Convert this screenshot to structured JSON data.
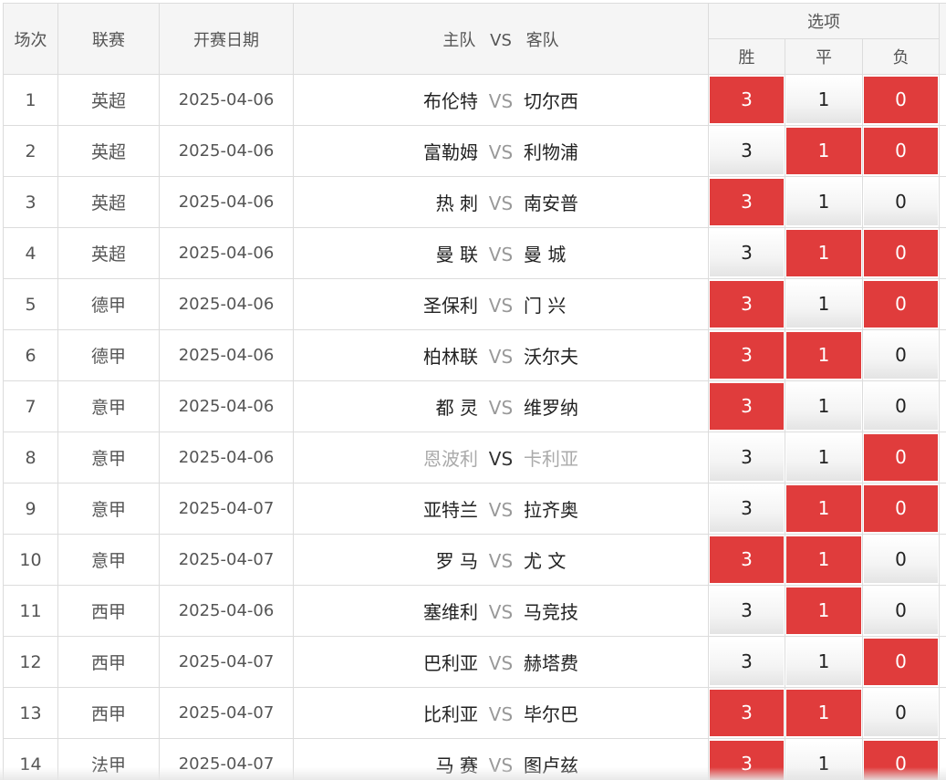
{
  "headers": {
    "num": "场次",
    "league": "联赛",
    "date": "开赛日期",
    "home": "主队",
    "vs": "VS",
    "away": "客队",
    "options": "选项",
    "win": "胜",
    "draw": "平",
    "lose": "负"
  },
  "colors": {
    "selected": "#e03c3c",
    "vs_text": "#999999"
  },
  "matches": [
    {
      "num": "1",
      "league": "英超",
      "date": "2025-04-06",
      "home": "布伦特",
      "vs": "VS",
      "away": "切尔西",
      "win": "3",
      "draw": "1",
      "lose": "0"
    },
    {
      "num": "2",
      "league": "英超",
      "date": "2025-04-06",
      "home": "富勒姆",
      "vs": "VS",
      "away": "利物浦",
      "win": "3",
      "draw": "1",
      "lose": "0"
    },
    {
      "num": "3",
      "league": "英超",
      "date": "2025-04-06",
      "home": "热 刺",
      "vs": "VS",
      "away": "南安普",
      "win": "3",
      "draw": "1",
      "lose": "0"
    },
    {
      "num": "4",
      "league": "英超",
      "date": "2025-04-06",
      "home": "曼 联",
      "vs": "VS",
      "away": "曼 城",
      "win": "3",
      "draw": "1",
      "lose": "0"
    },
    {
      "num": "5",
      "league": "德甲",
      "date": "2025-04-06",
      "home": "圣保利",
      "vs": "VS",
      "away": "门 兴",
      "win": "3",
      "draw": "1",
      "lose": "0"
    },
    {
      "num": "6",
      "league": "德甲",
      "date": "2025-04-06",
      "home": "柏林联",
      "vs": "VS",
      "away": "沃尔夫",
      "win": "3",
      "draw": "1",
      "lose": "0"
    },
    {
      "num": "7",
      "league": "意甲",
      "date": "2025-04-06",
      "home": "都 灵",
      "vs": "VS",
      "away": "维罗纳",
      "win": "3",
      "draw": "1",
      "lose": "0"
    },
    {
      "num": "8",
      "league": "意甲",
      "date": "2025-04-06",
      "home": "恩波利",
      "vs": "VS",
      "away": "卡利亚",
      "win": "3",
      "draw": "1",
      "lose": "0"
    },
    {
      "num": "9",
      "league": "意甲",
      "date": "2025-04-07",
      "home": "亚特兰",
      "vs": "VS",
      "away": "拉齐奥",
      "win": "3",
      "draw": "1",
      "lose": "0"
    },
    {
      "num": "10",
      "league": "意甲",
      "date": "2025-04-07",
      "home": "罗 马",
      "vs": "VS",
      "away": "尤 文",
      "win": "3",
      "draw": "1",
      "lose": "0"
    },
    {
      "num": "11",
      "league": "西甲",
      "date": "2025-04-06",
      "home": "塞维利",
      "vs": "VS",
      "away": "马竞技",
      "win": "3",
      "draw": "1",
      "lose": "0"
    },
    {
      "num": "12",
      "league": "西甲",
      "date": "2025-04-07",
      "home": "巴利亚",
      "vs": "VS",
      "away": "赫塔费",
      "win": "3",
      "draw": "1",
      "lose": "0"
    },
    {
      "num": "13",
      "league": "西甲",
      "date": "2025-04-07",
      "home": "比利亚",
      "vs": "VS",
      "away": "毕尔巴",
      "win": "3",
      "draw": "1",
      "lose": "0"
    },
    {
      "num": "14",
      "league": "法甲",
      "date": "2025-04-07",
      "home": "马 赛",
      "vs": "VS",
      "away": "图卢兹",
      "win": "3",
      "draw": "1",
      "lose": "0"
    }
  ],
  "selections": [
    {
      "win": true,
      "draw": false,
      "lose": true
    },
    {
      "win": false,
      "draw": true,
      "lose": true
    },
    {
      "win": true,
      "draw": false,
      "lose": false
    },
    {
      "win": false,
      "draw": true,
      "lose": true
    },
    {
      "win": true,
      "draw": false,
      "lose": true
    },
    {
      "win": true,
      "draw": true,
      "lose": false
    },
    {
      "win": true,
      "draw": false,
      "lose": false
    },
    {
      "win": false,
      "draw": false,
      "lose": true
    },
    {
      "win": false,
      "draw": true,
      "lose": true
    },
    {
      "win": true,
      "draw": true,
      "lose": false
    },
    {
      "win": false,
      "draw": true,
      "lose": false
    },
    {
      "win": false,
      "draw": false,
      "lose": true
    },
    {
      "win": true,
      "draw": true,
      "lose": false
    },
    {
      "win": true,
      "draw": false,
      "lose": true
    }
  ],
  "unavailable_rows": [
    8
  ]
}
